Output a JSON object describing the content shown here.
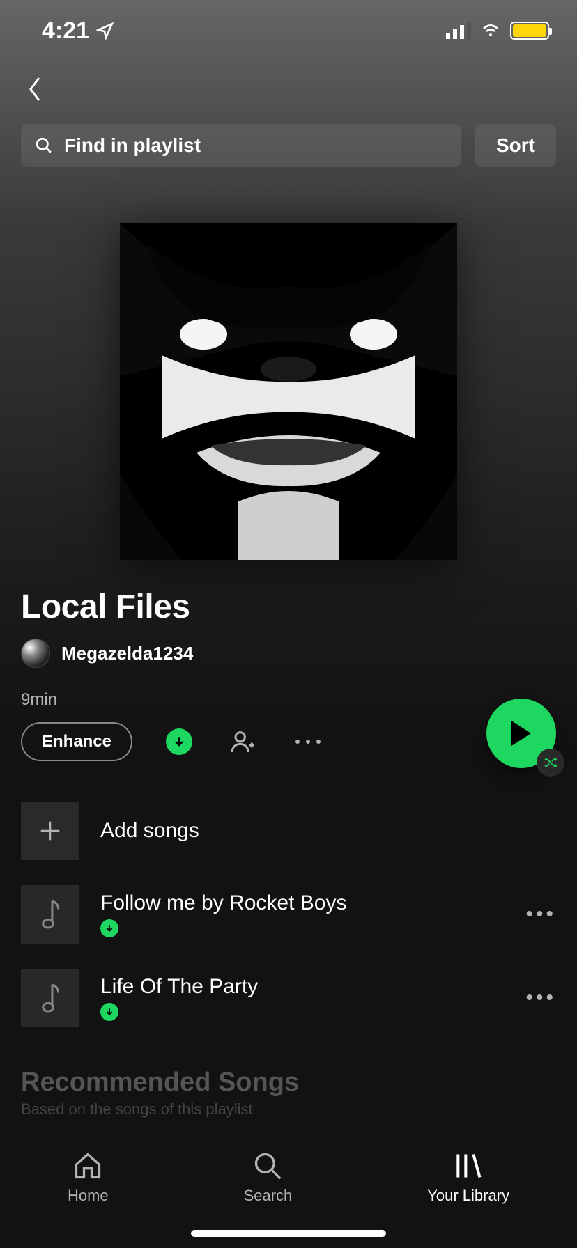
{
  "status": {
    "time": "4:21"
  },
  "search": {
    "placeholder": "Find in playlist",
    "sort": "Sort"
  },
  "playlist": {
    "title": "Local Files",
    "owner": "Megazelda1234",
    "duration": "9min",
    "enhance": "Enhance",
    "add_songs": "Add songs"
  },
  "tracks": [
    {
      "title": "Follow me by Rocket Boys",
      "downloaded": true
    },
    {
      "title": "Life Of The Party",
      "downloaded": true
    }
  ],
  "recommended": {
    "title": "Recommended Songs",
    "subtitle": "Based on the songs of this playlist"
  },
  "nav": {
    "home": "Home",
    "search": "Search",
    "library": "Your Library"
  },
  "colors": {
    "accent": "#1ed760"
  }
}
